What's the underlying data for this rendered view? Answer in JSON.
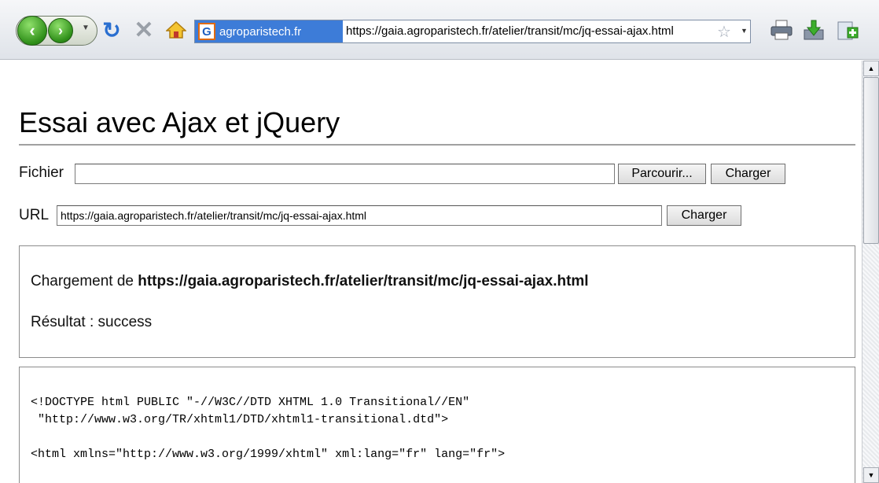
{
  "toolbar": {
    "back_icon": "back-arrow-icon",
    "forward_icon": "forward-arrow-icon",
    "reload_icon": "reload-icon",
    "stop_icon": "stop-icon",
    "home_icon": "home-icon",
    "site_identity": "agroparistech.fr",
    "url": "https://gaia.agroparistech.fr/atelier/transit/mc/jq-essai-ajax.html",
    "print_icon": "printer-icon",
    "download_icon": "download-icon",
    "addon_icon": "add-on-icon"
  },
  "page": {
    "title": "Essai avec Ajax et jQuery",
    "file_row": {
      "label": "Fichier",
      "value": "",
      "browse_label": "Parcourir...",
      "load_label": "Charger"
    },
    "url_row": {
      "label": "URL",
      "value": "https://gaia.agroparistech.fr/atelier/transit/mc/jq-essai-ajax.html",
      "load_label": "Charger"
    },
    "status": {
      "prefix": "Chargement de",
      "url": "https://gaia.agroparistech.fr/atelier/transit/mc/jq-essai-ajax.html",
      "result": "Résultat : success"
    },
    "source": {
      "line1": "<!DOCTYPE html PUBLIC \"-//W3C//DTD XHTML 1.0 Transitional//EN\"",
      "line2": " \"http://www.w3.org/TR/xhtml1/DTD/xhtml1-transitional.dtd\">",
      "line3": "",
      "line4": "<html xmlns=\"http://www.w3.org/1999/xhtml\" xml:lang=\"fr\" lang=\"fr\">"
    }
  },
  "colors": {
    "site_identity_bg": "#3d7cd8",
    "nav_green": "#2f8f19",
    "reload_blue": "#2a6fd0"
  }
}
